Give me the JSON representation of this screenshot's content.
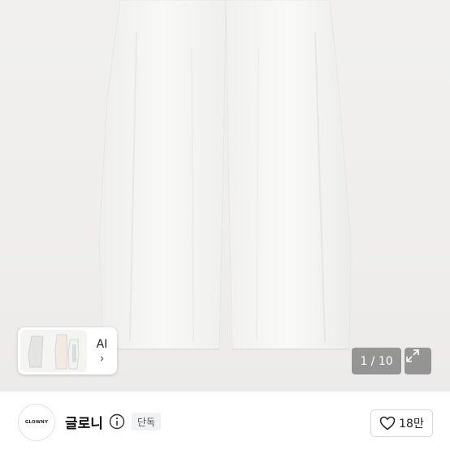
{
  "gallery": {
    "counter_current": "1",
    "counter_total": "10",
    "counter_separator": " / ",
    "ai_label": "AI",
    "ai_chevron": "›",
    "expand_icon": "expand-arrows-icon"
  },
  "seller": {
    "logo_text": "GLOWNY",
    "name": "글로니",
    "badge": "단독",
    "info_icon": "info-circle-icon"
  },
  "like": {
    "count": "18만",
    "icon": "heart-outline-icon"
  },
  "colors": {
    "photo_bg": "#efeeec",
    "pants": "#f7f7f5",
    "overlay": "#5f5f5f"
  }
}
